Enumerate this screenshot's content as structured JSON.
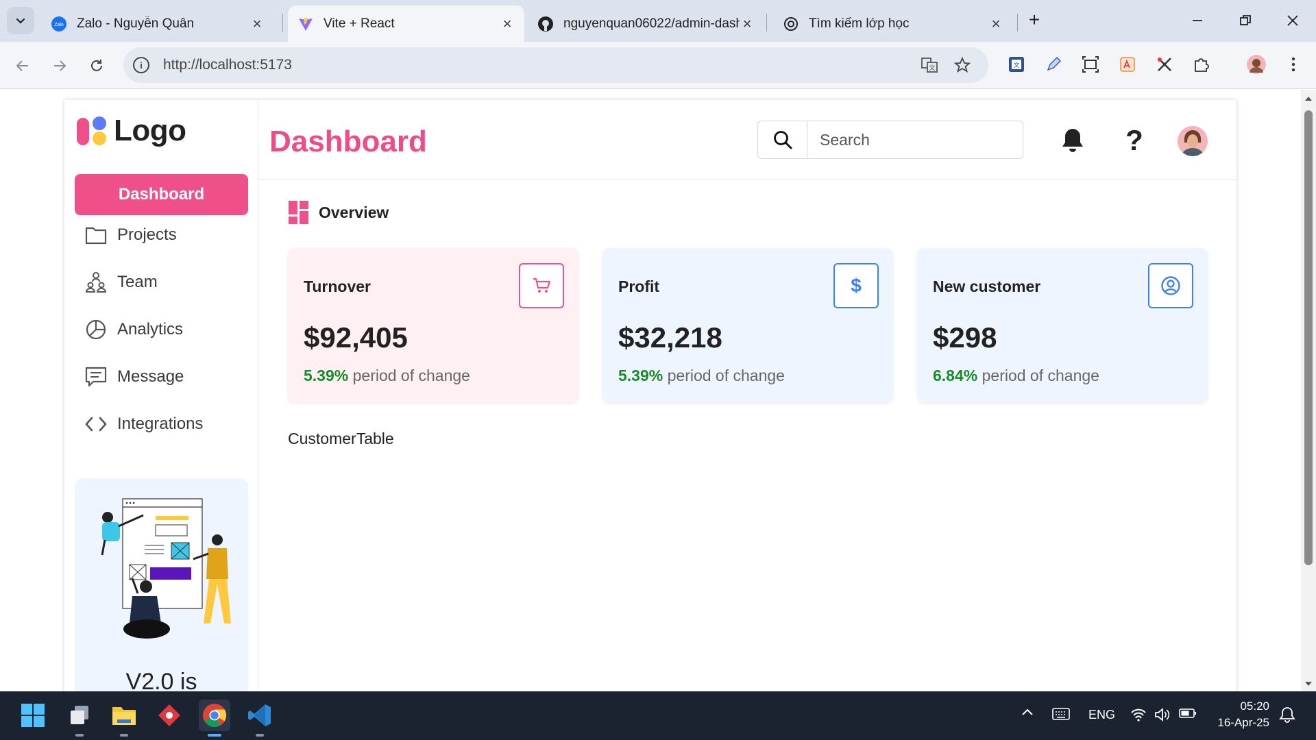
{
  "browser": {
    "tabs": [
      {
        "title": "Zalo - Nguyễn Quân",
        "icon": "zalo-icon",
        "active": false
      },
      {
        "title": "Vite + React",
        "icon": "vite-icon",
        "active": true
      },
      {
        "title": "nguyenquan06022/admin-dash",
        "icon": "github-icon",
        "active": false
      },
      {
        "title": "Tìm kiếm lớp học",
        "icon": "openai-icon",
        "active": false
      }
    ],
    "url": "http://localhost:5173"
  },
  "sidebar": {
    "logo_text": "Logo",
    "items": [
      {
        "label": "Dashboard",
        "icon": "dashboard-icon",
        "active": true
      },
      {
        "label": "Projects",
        "icon": "folder-icon"
      },
      {
        "label": "Team",
        "icon": "team-icon"
      },
      {
        "label": "Analytics",
        "icon": "pie-chart-icon"
      },
      {
        "label": "Message",
        "icon": "message-icon"
      },
      {
        "label": "Integrations",
        "icon": "code-icon"
      }
    ],
    "promo_text": "V2.0 is"
  },
  "header": {
    "title": "Dashboard",
    "search_placeholder": "Search"
  },
  "main": {
    "overview_label": "Overview",
    "cards": [
      {
        "label": "Turnover",
        "value": "$92,405",
        "change_pct": "5.39%",
        "change_text": "period of change",
        "icon": "cart-icon",
        "bg": "#fff0f4",
        "accent": "#f0508a"
      },
      {
        "label": "Profit",
        "value": "$32,218",
        "change_pct": "5.39%",
        "change_text": "period of change",
        "icon": "dollar-icon",
        "bg": "#eff5fe",
        "accent": "#3b82f6"
      },
      {
        "label": "New customer",
        "value": "$298",
        "change_pct": "6.84%",
        "change_text": "period of change",
        "icon": "user-circle-icon",
        "bg": "#eff5fe",
        "accent": "#3b82f6"
      }
    ],
    "table_placeholder": "CustomerTable"
  },
  "taskbar": {
    "language": "ENG",
    "time": "05:20",
    "date": "16-Apr-25"
  },
  "colors": {
    "accent_pink": "#ee4c87",
    "positive_green": "#1a8a2a",
    "accent_blue": "#3b82f6"
  }
}
